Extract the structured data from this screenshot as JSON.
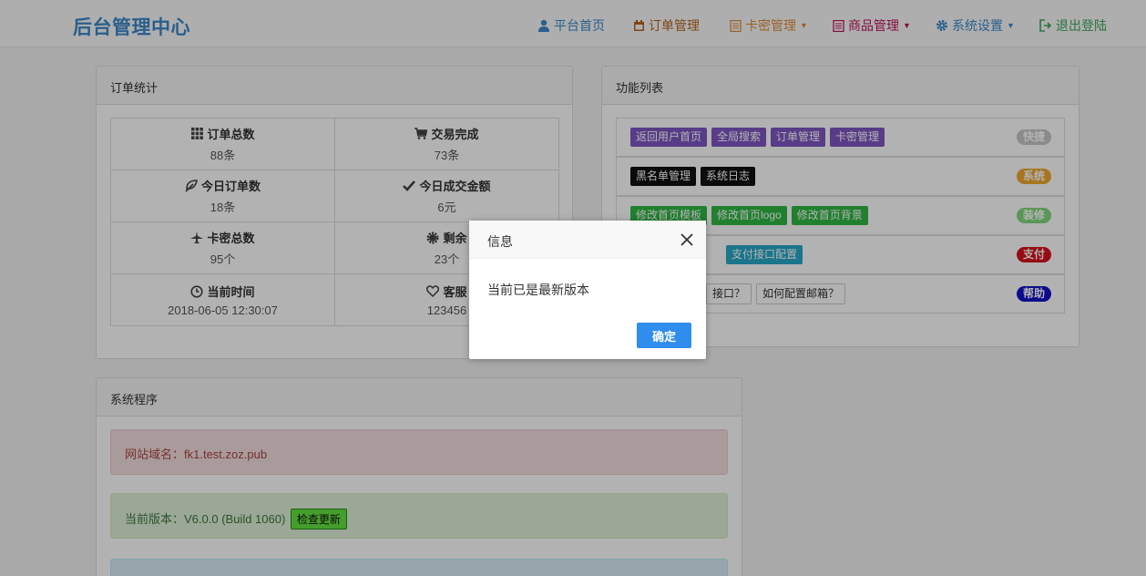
{
  "brand": "后台管理中心",
  "nav": {
    "home": "平台首页",
    "orders": "订单管理",
    "cards": "卡密管理",
    "goods": "商品管理",
    "settings": "系统设置",
    "logout": "退出登陆"
  },
  "colors": {
    "home": "#3c89c9",
    "orders": "#b5651d",
    "cards": "#e08a3a",
    "goods": "#c0145a",
    "settings": "#3c89c9",
    "logout": "#3aa85a"
  },
  "order_stats": {
    "title": "订单统计",
    "cells": [
      {
        "label": "订单总数",
        "value": "88条",
        "icon": "grid-icon"
      },
      {
        "label": "交易完成",
        "value": "73条",
        "icon": "cart-icon"
      },
      {
        "label": "今日订单数",
        "value": "18条",
        "icon": "leaf-icon"
      },
      {
        "label": "今日成交金额",
        "value": "6元",
        "icon": "check-icon"
      },
      {
        "label": "卡密总数",
        "value": "95个",
        "icon": "plane-icon"
      },
      {
        "label": "剩余",
        "value": "23个",
        "icon": "cog-icon"
      },
      {
        "label": "当前时间",
        "value": "2018-06-05 12:30:07",
        "icon": "clock-icon"
      },
      {
        "label": "客服",
        "value": "123456",
        "icon": "heart-icon"
      }
    ]
  },
  "functions": {
    "title": "功能列表",
    "rows": [
      {
        "items": [
          "返回用户首页",
          "全局搜索",
          "订单管理",
          "卡密管理"
        ],
        "badge": "快捷"
      },
      {
        "items": [
          "黑名单管理",
          "系统日志"
        ],
        "badge": "系统"
      },
      {
        "items": [
          "修改首页模板",
          "修改首页logo",
          "修改首页背景"
        ],
        "badge": "装修"
      },
      {
        "items": [
          "支付接口配置"
        ],
        "badge": "支付"
      },
      {
        "items": [
          "接口？",
          "如何配置邮箱？"
        ],
        "badge": "帮助"
      }
    ]
  },
  "system": {
    "title": "系统程序",
    "domain_line": "网站域名：fk1.test.zoz.pub",
    "version_line": "当前版本：V6.0.0 (Build 1060)",
    "check_update": "检查更新"
  },
  "dialog": {
    "title": "信息",
    "message": "当前已是最新版本",
    "ok": "确定"
  }
}
